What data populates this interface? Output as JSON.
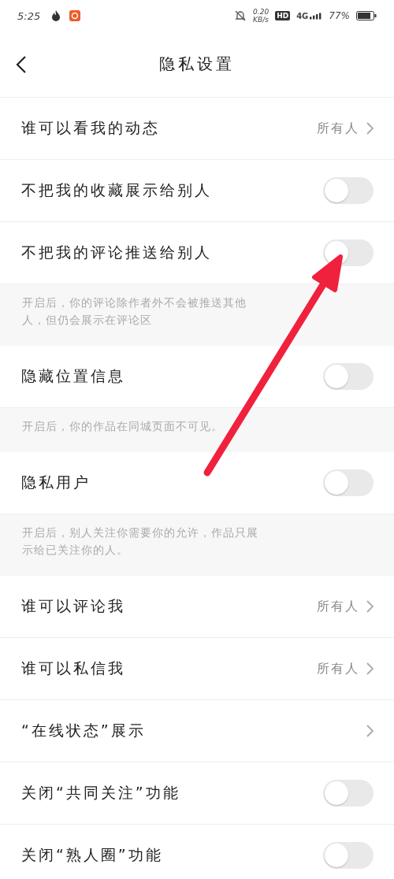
{
  "status_bar": {
    "time": "5:25",
    "net_speed": "0.20",
    "net_unit": "KB/s",
    "hd": "HD",
    "network": "4G",
    "battery": "77%"
  },
  "header": {
    "title": "隐私设置"
  },
  "rows": [
    {
      "kind": "link",
      "label": "谁可以看我的动态",
      "value": "所有人"
    },
    {
      "kind": "toggle",
      "label": "不把我的收藏展示给别人",
      "on": false
    },
    {
      "kind": "toggle",
      "label": "不把我的评论推送给别人",
      "on": false
    },
    {
      "kind": "note",
      "text": "开启后，你的评论除作者外不会被推送其他人，但仍会展示在评论区"
    },
    {
      "kind": "toggle",
      "label": "隐藏位置信息",
      "on": false
    },
    {
      "kind": "note",
      "text": "开启后，你的作品在同城页面不可见。"
    },
    {
      "kind": "toggle",
      "label": "隐私用户",
      "on": false
    },
    {
      "kind": "note",
      "text": "开启后，别人关注你需要你的允许，作品只展示给已关注你的人。"
    },
    {
      "kind": "link",
      "label": "谁可以评论我",
      "value": "所有人"
    },
    {
      "kind": "link",
      "label": "谁可以私信我",
      "value": "所有人"
    },
    {
      "kind": "link",
      "label": "“在线状态”展示"
    },
    {
      "kind": "toggle",
      "label": "关闭“共同关注”功能",
      "on": false
    },
    {
      "kind": "toggle",
      "label": "关闭“熟人圈”功能",
      "on": false
    }
  ]
}
